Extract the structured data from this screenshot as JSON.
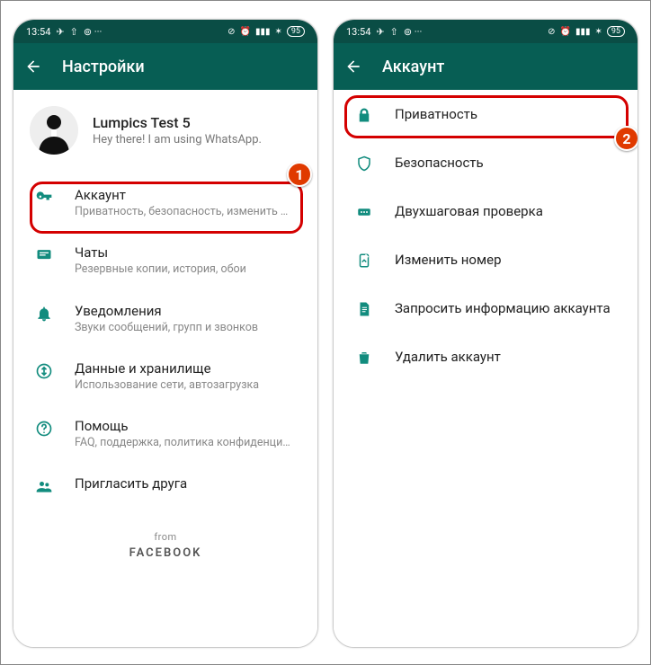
{
  "statusbar": {
    "time": "13:54",
    "battery": "95"
  },
  "left": {
    "title": "Настройки",
    "profile": {
      "name": "Lumpics Test 5",
      "status": "Hey there! I am using WhatsApp."
    },
    "items": [
      {
        "label": "Аккаунт",
        "sub": "Приватность, безопасность, изменить номер"
      },
      {
        "label": "Чаты",
        "sub": "Резервные копии, история, обои"
      },
      {
        "label": "Уведомления",
        "sub": "Звуки сообщений, групп и звонков"
      },
      {
        "label": "Данные и хранилище",
        "sub": "Использование сети, автозагрузка"
      },
      {
        "label": "Помощь",
        "sub": "FAQ, поддержка, политика конфиденциальн..."
      },
      {
        "label": "Пригласить друга",
        "sub": ""
      }
    ],
    "footer_from": "from",
    "footer_brand": "FACEBOOK"
  },
  "right": {
    "title": "Аккаунт",
    "items": [
      {
        "label": "Приватность"
      },
      {
        "label": "Безопасность"
      },
      {
        "label": "Двухшаговая проверка"
      },
      {
        "label": "Изменить номер"
      },
      {
        "label": "Запросить информацию аккаунта"
      },
      {
        "label": "Удалить аккаунт"
      }
    ]
  },
  "callouts": {
    "left_badge": "1",
    "right_badge": "2"
  }
}
